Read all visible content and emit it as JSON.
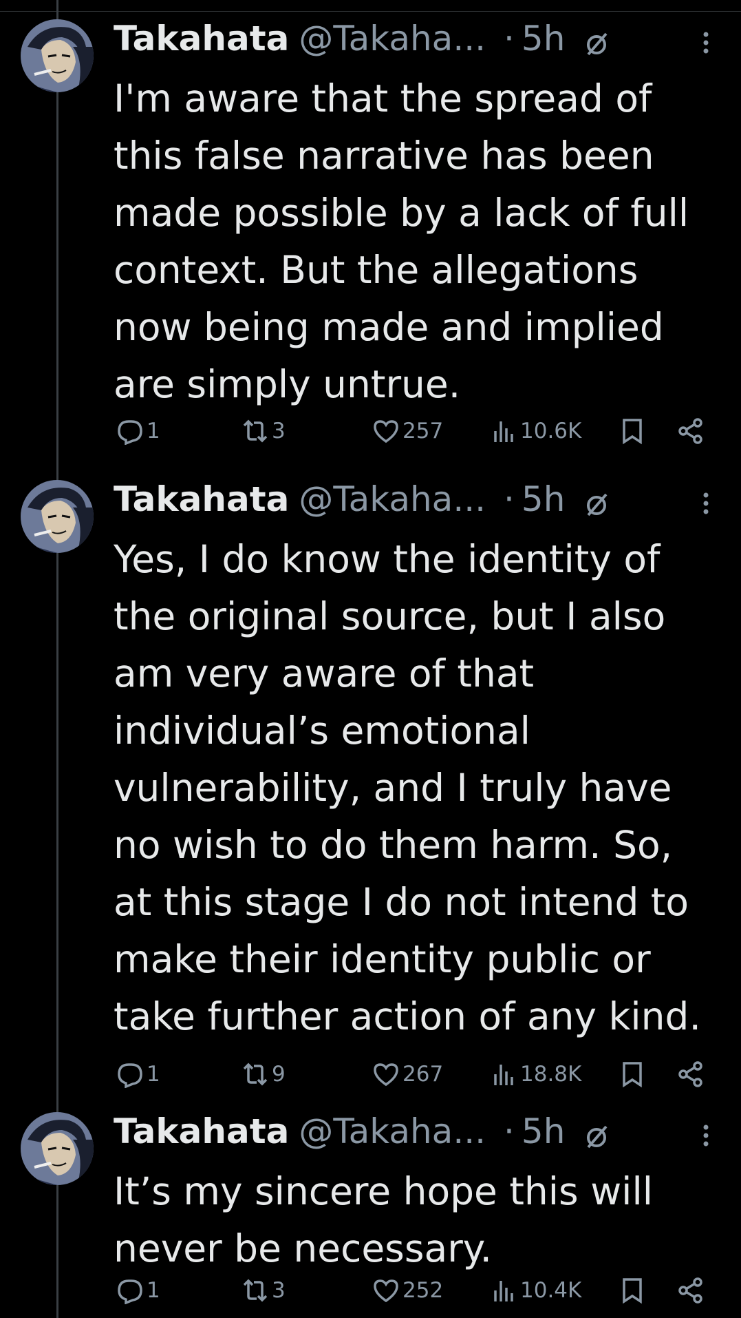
{
  "tweets": [
    {
      "name": "Takahata",
      "handle": "@Takaha...",
      "dot": "·",
      "time": "5h",
      "text": "I'm aware that the spread of\nthis false narrative has been\nmade possible by a lack of full\ncontext. But the allegations\nnow being made and implied\nare simply untrue.",
      "replies": "1",
      "retweets": "3",
      "likes": "257",
      "views": "10.6K"
    },
    {
      "name": "Takahata",
      "handle": "@Takaha...",
      "dot": "·",
      "time": "5h",
      "text": "Yes, I do know the identity of\nthe original source, but I also\nam very aware of that\nindividual’s emotional\nvulnerability, and I truly have\nno wish to do them harm. So,\nat this stage I do not intend to\nmake their identity public or\ntake further action of any kind.",
      "replies": "1",
      "retweets": "9",
      "likes": "267",
      "views": "18.8K"
    },
    {
      "name": "Takahata",
      "handle": "@Takaha...",
      "dot": "·",
      "time": "5h",
      "text": "It’s my sincere hope this will\nnever be necessary.",
      "replies": "1",
      "retweets": "3",
      "likes": "252",
      "views": "10.4K"
    }
  ],
  "icons": {
    "reply": "reply-icon",
    "retweet": "retweet-icon",
    "like": "heart-icon",
    "views": "views-icon",
    "bookmark": "bookmark-icon",
    "share": "share-icon",
    "time_limited": "slashed-circle-icon",
    "more": "more-icon"
  },
  "colors": {
    "background": "#000000",
    "text": "#e7e9ea",
    "muted": "#8b98a5",
    "thread_line": "#3a3f44"
  }
}
